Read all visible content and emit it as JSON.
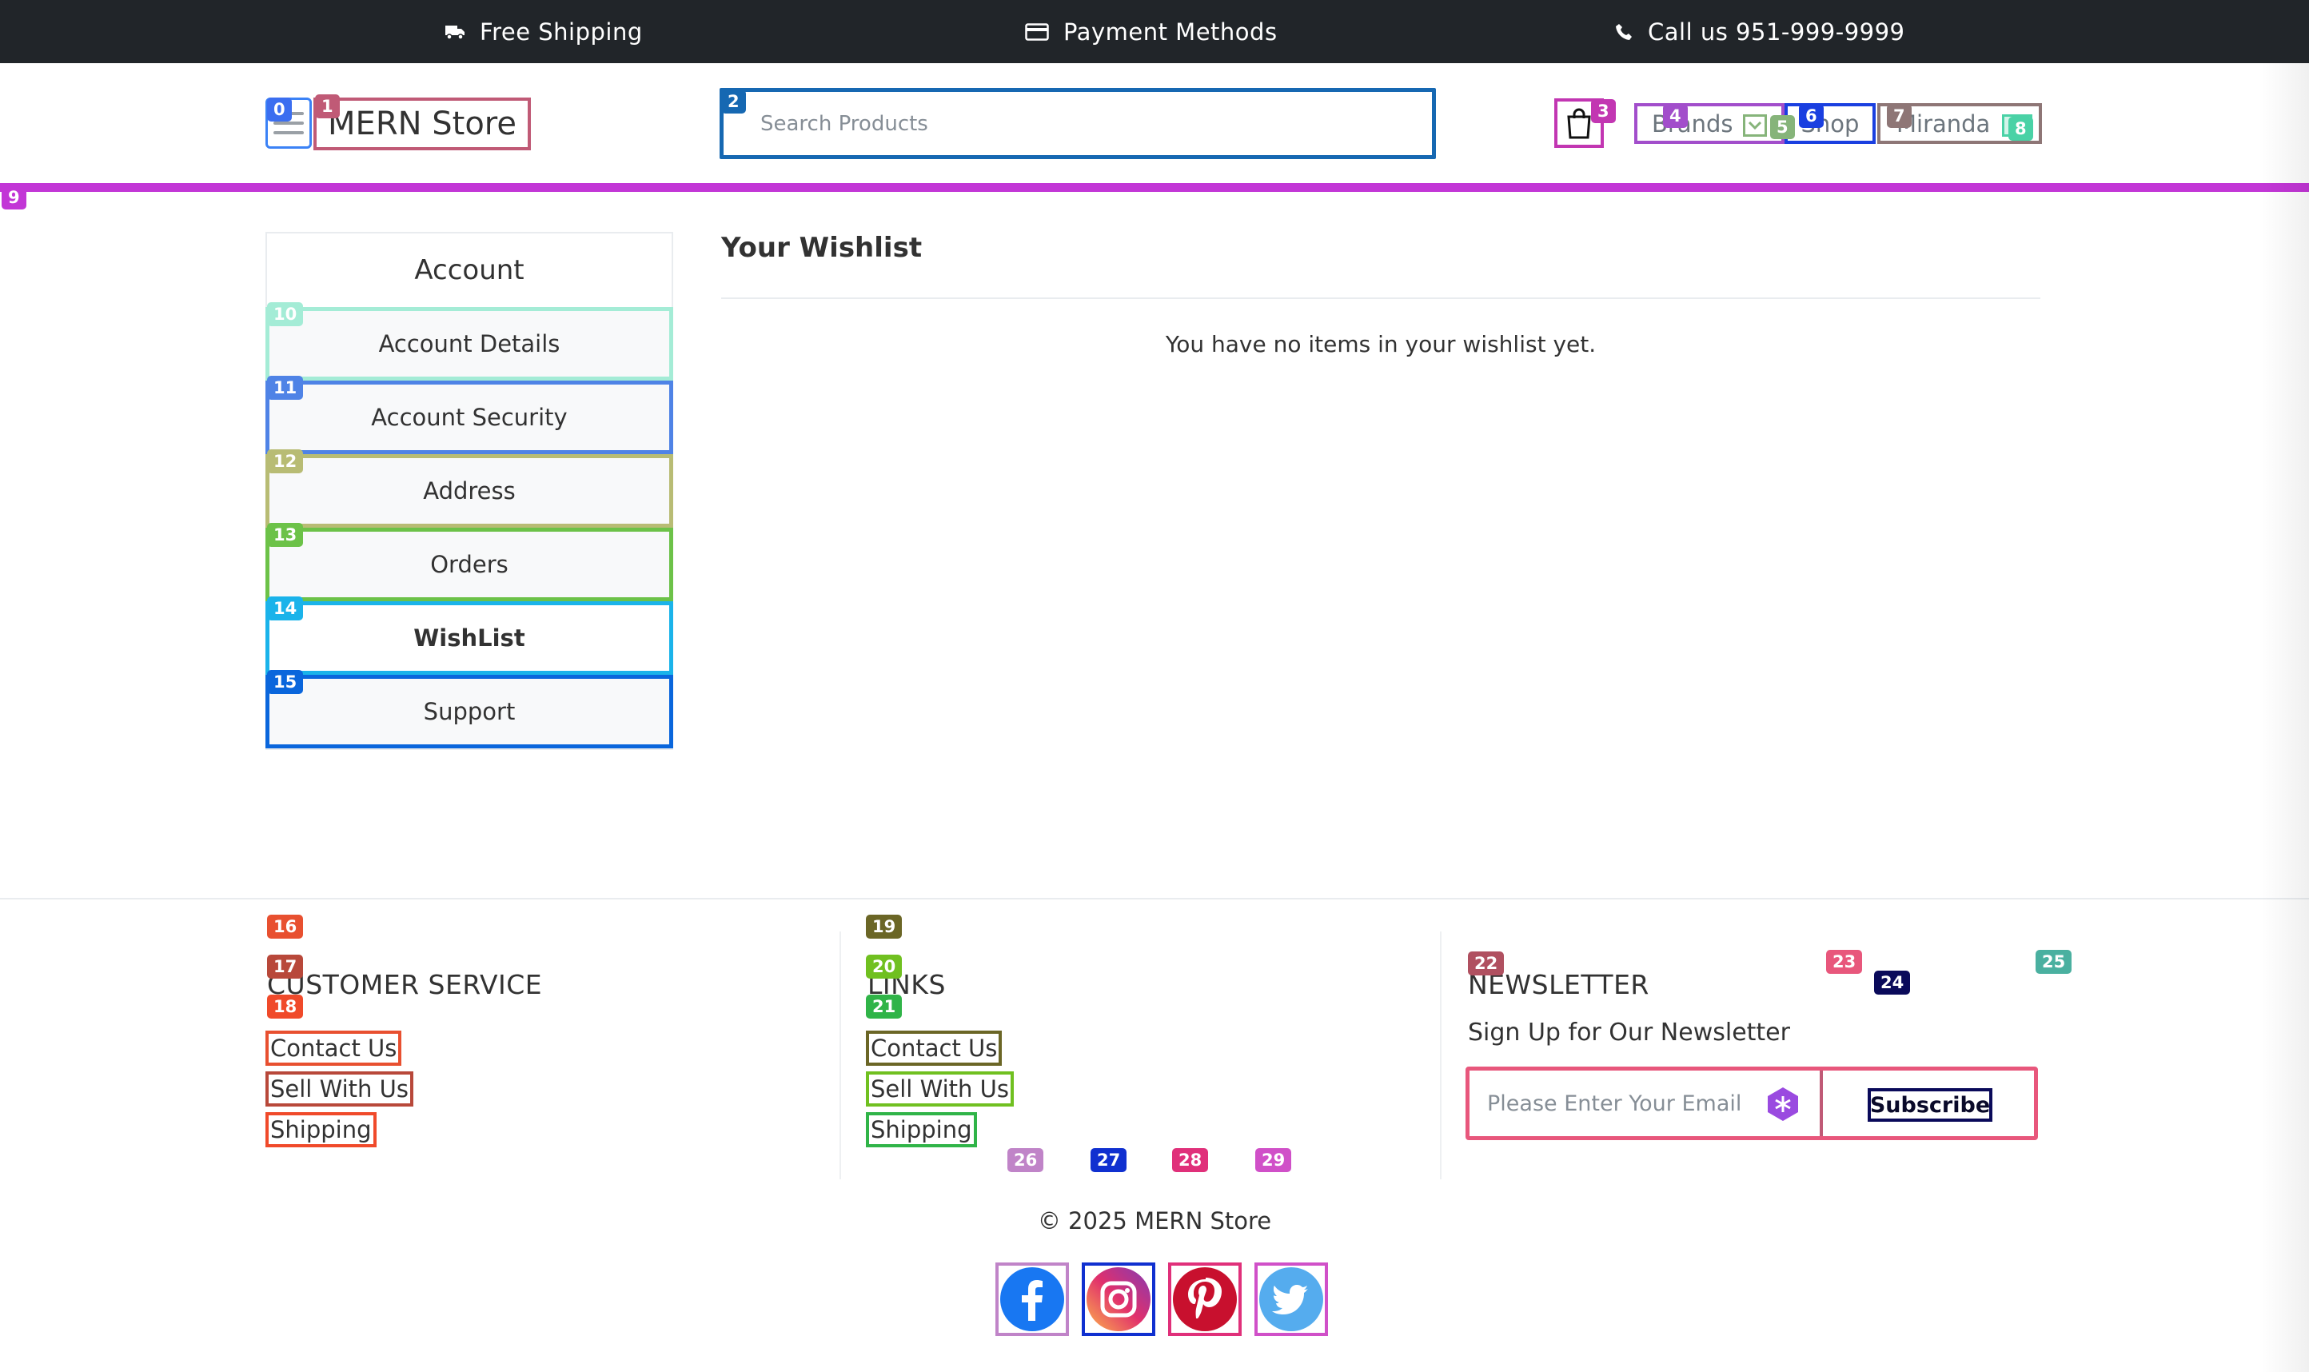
{
  "topbar": {
    "shipping": "Free Shipping",
    "payment": "Payment Methods",
    "phone": "Call us 951-999-9999"
  },
  "header": {
    "brand": "MERN Store",
    "search_placeholder": "Search Products",
    "nav_brands": "Brands",
    "nav_shop": "Shop",
    "nav_user": "Miranda"
  },
  "sidebar": {
    "title": "Account",
    "items": [
      {
        "label": "Account Details"
      },
      {
        "label": "Account Security"
      },
      {
        "label": "Address"
      },
      {
        "label": "Orders"
      },
      {
        "label": "WishList"
      },
      {
        "label": "Support"
      }
    ]
  },
  "main": {
    "title": "Your Wishlist",
    "empty_message": "You have no items in your wishlist yet."
  },
  "footer": {
    "customer_service": {
      "title": "CUSTOMER SERVICE",
      "links": [
        "Contact Us",
        "Sell With Us",
        "Shipping"
      ]
    },
    "links": {
      "title": "LINKS",
      "links": [
        "Contact Us",
        "Sell With Us",
        "Shipping"
      ]
    },
    "newsletter": {
      "title": "NEWSLETTER",
      "subtitle": "Sign Up for Our Newsletter",
      "email_placeholder": "Please Enter Your Email",
      "subscribe_label": "Subscribe"
    },
    "copyright": "© 2025 MERN Store",
    "social": [
      "facebook-icon",
      "instagram-icon",
      "pinterest-icon",
      "twitter-icon"
    ]
  },
  "markers": [
    "0",
    "1",
    "2",
    "3",
    "4",
    "5",
    "6",
    "7",
    "8",
    "9",
    "10",
    "11",
    "12",
    "13",
    "14",
    "15",
    "16",
    "17",
    "18",
    "19",
    "20",
    "21",
    "22",
    "23",
    "24",
    "25",
    "26",
    "27",
    "28",
    "29"
  ],
  "colors": {
    "topbar_bg": "#212529",
    "accent_bar": "#c236d6",
    "text": "#323232",
    "muted": "#6c757d"
  }
}
